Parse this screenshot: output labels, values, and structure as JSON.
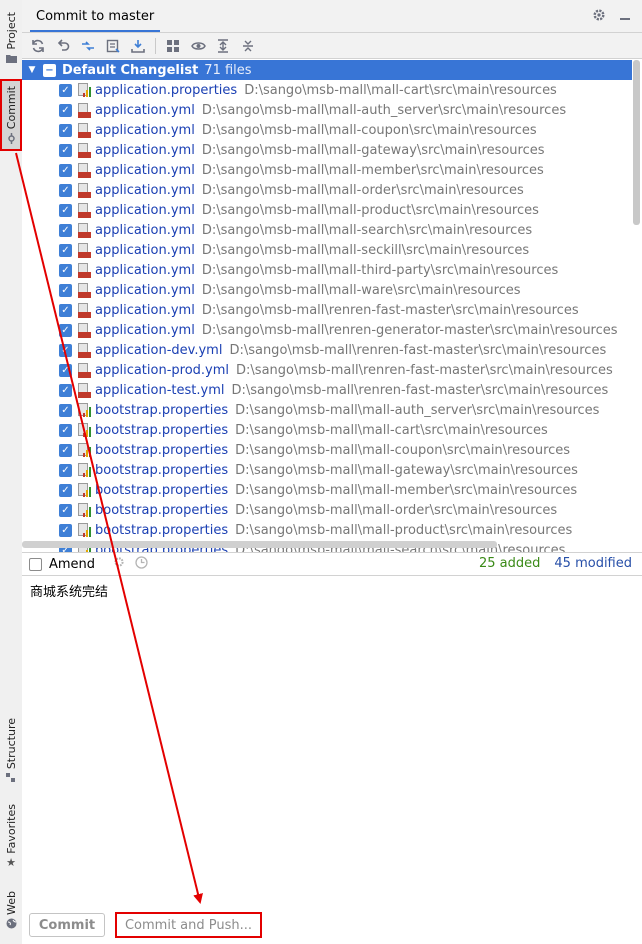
{
  "window": {
    "title": "Commit to master"
  },
  "side_tabs": [
    {
      "label": "Project",
      "icon": "folder-icon"
    },
    {
      "label": "Commit",
      "icon": "commit-icon"
    },
    {
      "label": "Structure",
      "icon": "structure-icon"
    },
    {
      "label": "Favorites",
      "icon": "star-icon"
    },
    {
      "label": "Web",
      "icon": "globe-icon"
    }
  ],
  "header_icons": [
    "gear-icon",
    "minimize-icon"
  ],
  "toolbar": [
    "refresh-icon",
    "rollback-icon",
    "show-diff-icon",
    "jump-to-source-icon",
    "shelve-icon",
    "group-by-icon",
    "preview-icon",
    "expand-all-icon",
    "collapse-all-icon"
  ],
  "changelist": {
    "name": "Default Changelist",
    "count": "71 files"
  },
  "files": [
    {
      "name": "application.properties",
      "path": "D:\\sango\\msb-mall\\mall-cart\\src\\main\\resources",
      "type": "properties"
    },
    {
      "name": "application.yml",
      "path": "D:\\sango\\msb-mall\\mall-auth_server\\src\\main\\resources",
      "type": "yml"
    },
    {
      "name": "application.yml",
      "path": "D:\\sango\\msb-mall\\mall-coupon\\src\\main\\resources",
      "type": "yml"
    },
    {
      "name": "application.yml",
      "path": "D:\\sango\\msb-mall\\mall-gateway\\src\\main\\resources",
      "type": "yml"
    },
    {
      "name": "application.yml",
      "path": "D:\\sango\\msb-mall\\mall-member\\src\\main\\resources",
      "type": "yml"
    },
    {
      "name": "application.yml",
      "path": "D:\\sango\\msb-mall\\mall-order\\src\\main\\resources",
      "type": "yml"
    },
    {
      "name": "application.yml",
      "path": "D:\\sango\\msb-mall\\mall-product\\src\\main\\resources",
      "type": "yml"
    },
    {
      "name": "application.yml",
      "path": "D:\\sango\\msb-mall\\mall-search\\src\\main\\resources",
      "type": "yml"
    },
    {
      "name": "application.yml",
      "path": "D:\\sango\\msb-mall\\mall-seckill\\src\\main\\resources",
      "type": "yml"
    },
    {
      "name": "application.yml",
      "path": "D:\\sango\\msb-mall\\mall-third-party\\src\\main\\resources",
      "type": "yml"
    },
    {
      "name": "application.yml",
      "path": "D:\\sango\\msb-mall\\mall-ware\\src\\main\\resources",
      "type": "yml"
    },
    {
      "name": "application.yml",
      "path": "D:\\sango\\msb-mall\\renren-fast-master\\src\\main\\resources",
      "type": "yml"
    },
    {
      "name": "application.yml",
      "path": "D:\\sango\\msb-mall\\renren-generator-master\\src\\main\\resources",
      "type": "yml"
    },
    {
      "name": "application-dev.yml",
      "path": "D:\\sango\\msb-mall\\renren-fast-master\\src\\main\\resources",
      "type": "yml"
    },
    {
      "name": "application-prod.yml",
      "path": "D:\\sango\\msb-mall\\renren-fast-master\\src\\main\\resources",
      "type": "yml"
    },
    {
      "name": "application-test.yml",
      "path": "D:\\sango\\msb-mall\\renren-fast-master\\src\\main\\resources",
      "type": "yml"
    },
    {
      "name": "bootstrap.properties",
      "path": "D:\\sango\\msb-mall\\mall-auth_server\\src\\main\\resources",
      "type": "properties"
    },
    {
      "name": "bootstrap.properties",
      "path": "D:\\sango\\msb-mall\\mall-cart\\src\\main\\resources",
      "type": "properties"
    },
    {
      "name": "bootstrap.properties",
      "path": "D:\\sango\\msb-mall\\mall-coupon\\src\\main\\resources",
      "type": "properties"
    },
    {
      "name": "bootstrap.properties",
      "path": "D:\\sango\\msb-mall\\mall-gateway\\src\\main\\resources",
      "type": "properties"
    },
    {
      "name": "bootstrap.properties",
      "path": "D:\\sango\\msb-mall\\mall-member\\src\\main\\resources",
      "type": "properties"
    },
    {
      "name": "bootstrap.properties",
      "path": "D:\\sango\\msb-mall\\mall-order\\src\\main\\resources",
      "type": "properties"
    },
    {
      "name": "bootstrap.properties",
      "path": "D:\\sango\\msb-mall\\mall-product\\src\\main\\resources",
      "type": "properties"
    },
    {
      "name": "bootstrap.properties",
      "path": "D:\\sango\\msb-mall\\mall-search\\src\\main\\resources",
      "type": "properties"
    }
  ],
  "amend": {
    "label": "Amend"
  },
  "stats": {
    "added": "25 added",
    "modified": "45 modified"
  },
  "commit_message": "商城系统完结",
  "buttons": {
    "commit": "Commit",
    "commit_and_push": "Commit and Push..."
  },
  "colors": {
    "accent": "#3875d6",
    "annotation": "#e30000",
    "added": "#3a8a17",
    "modified": "#274fa8"
  }
}
